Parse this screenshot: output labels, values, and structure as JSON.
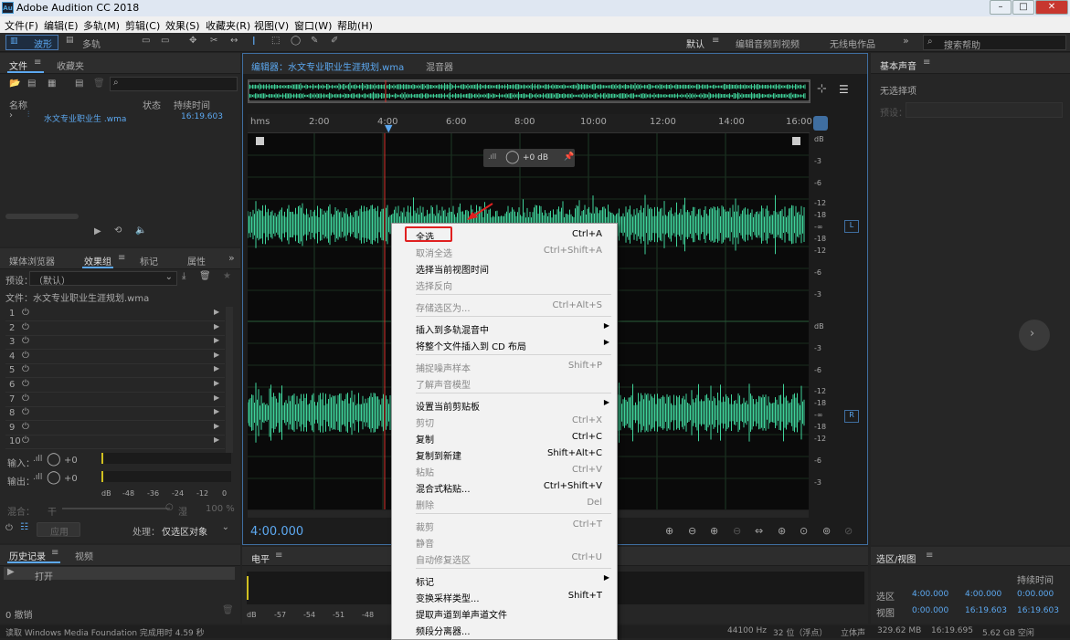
{
  "window": {
    "title": "Adobe Audition CC 2018",
    "app_icon_text": "Au"
  },
  "menu": [
    "文件(F)",
    "编辑(E)",
    "多轨(M)",
    "剪辑(C)",
    "效果(S)",
    "收藏夹(R)",
    "视图(V)",
    "窗口(W)",
    "帮助(H)"
  ],
  "toolbar": {
    "waveform": "波形",
    "multitrack": "多轨",
    "workspace_default": "默认",
    "workspace_edit_video": "编辑音频到视频",
    "workspace_radio": "无线电作品",
    "search_placeholder": "搜索帮助"
  },
  "files_panel": {
    "tab_files": "文件",
    "tab_favorites": "收藏夹",
    "col_name": "名称",
    "col_status": "状态",
    "col_duration": "持续时间",
    "file_name": "水文专业职业生 .wma",
    "file_duration": "16:19.603"
  },
  "effects_panel": {
    "tab_media": "媒体浏览器",
    "tab_effects": "效果组",
    "tab_markers": "标记",
    "tab_props": "属性",
    "preset_label": "预设：",
    "preset_value": "（默认）",
    "file_label": "文件：水文专业职业生涯规划.wma",
    "slots": [
      "1",
      "2",
      "3",
      "4",
      "5",
      "6",
      "7",
      "8",
      "9",
      "10"
    ],
    "input_label": "输入：",
    "output_label": "输出：",
    "input_db": "+0",
    "output_db": "+0",
    "meter_ticks": [
      "dB",
      "-48",
      "-36",
      "-24",
      "-12",
      "0"
    ],
    "mix_label": "混合：",
    "mix_dry": "干",
    "mix_wet": "湿",
    "mix_pct": "100 %",
    "apply_btn": "应用",
    "process_label": "处理：",
    "process_value": "仅选区对象"
  },
  "history_panel": {
    "tab_history": "历史记录",
    "tab_video": "视频",
    "item": "打开",
    "undo_count": "0 撤销"
  },
  "editor": {
    "tab_editor": "编辑器：水文专业职业生涯规划.wma",
    "tab_mixer": "混音器",
    "ruler_unit": "hms",
    "ruler": [
      "2:00",
      "4:00",
      "6:00",
      "8:00",
      "10:00",
      "12:00",
      "14:00",
      "16:00"
    ],
    "hud_db": "+0 dB",
    "time_display": "4:00.000",
    "channel_L": "L",
    "channel_R": "R",
    "db_scale": [
      "dB",
      "-3",
      "-6",
      "-12",
      "-18",
      "-∞",
      "-18",
      "-12",
      "-6",
      "-3"
    ]
  },
  "levels_panel": {
    "title": "电平",
    "ticks": [
      "dB",
      "-57",
      "-54",
      "-51",
      "-48",
      "-45",
      "-42"
    ]
  },
  "essential_sound": {
    "title": "基本声音",
    "no_selection": "无选择项",
    "preset_label": "预设："
  },
  "selection_panel": {
    "title": "选区/视图",
    "col_duration": "持续时间",
    "row_sel": "选区",
    "row_view": "视图",
    "sel_start": "4:00.000",
    "sel_end": "4:00.000",
    "sel_dur": "0:00.000",
    "view_start": "0:00.000",
    "view_end": "16:19.603",
    "view_dur": "16:19.603"
  },
  "context_menu": [
    {
      "label": "全选",
      "shortcut": "Ctrl+A",
      "enabled": true,
      "highlight": true
    },
    {
      "label": "取消全选",
      "shortcut": "Ctrl+Shift+A",
      "enabled": false
    },
    {
      "label": "选择当前视图时间",
      "shortcut": "",
      "enabled": true
    },
    {
      "label": "选择反向",
      "shortcut": "",
      "enabled": false
    },
    {
      "sep": true
    },
    {
      "label": "存储选区为...",
      "shortcut": "Ctrl+Alt+S",
      "enabled": false
    },
    {
      "sep": true
    },
    {
      "label": "插入到多轨混音中",
      "shortcut": "",
      "enabled": true,
      "submenu": true
    },
    {
      "label": "将整个文件插入到 CD 布局",
      "shortcut": "",
      "enabled": true,
      "submenu": true
    },
    {
      "sep": true
    },
    {
      "label": "捕捉噪声样本",
      "shortcut": "Shift+P",
      "enabled": false
    },
    {
      "label": "了解声音模型",
      "shortcut": "",
      "enabled": false
    },
    {
      "sep": true
    },
    {
      "label": "设置当前剪贴板",
      "shortcut": "",
      "enabled": true,
      "submenu": true
    },
    {
      "label": "剪切",
      "shortcut": "Ctrl+X",
      "enabled": false
    },
    {
      "label": "复制",
      "shortcut": "Ctrl+C",
      "enabled": true
    },
    {
      "label": "复制到新建",
      "shortcut": "Shift+Alt+C",
      "enabled": true
    },
    {
      "label": "粘贴",
      "shortcut": "Ctrl+V",
      "enabled": false
    },
    {
      "label": "混合式粘贴...",
      "shortcut": "Ctrl+Shift+V",
      "enabled": true
    },
    {
      "label": "删除",
      "shortcut": "Del",
      "enabled": false
    },
    {
      "sep": true
    },
    {
      "label": "裁剪",
      "shortcut": "Ctrl+T",
      "enabled": false
    },
    {
      "label": "静音",
      "shortcut": "",
      "enabled": false
    },
    {
      "label": "自动修复选区",
      "shortcut": "Ctrl+U",
      "enabled": false
    },
    {
      "sep": true
    },
    {
      "label": "标记",
      "shortcut": "",
      "enabled": true,
      "submenu": true
    },
    {
      "label": "变换采样类型...",
      "shortcut": "Shift+T",
      "enabled": true
    },
    {
      "label": "提取声道到单声道文件",
      "shortcut": "",
      "enabled": true
    },
    {
      "label": "频段分离器...",
      "shortcut": "",
      "enabled": true
    }
  ],
  "status": {
    "left": "读取 Windows Media Foundation 完成用时 4.59 秒",
    "rate": "44100 Hz",
    "bits": "32 位（浮点）",
    "stereo": "立体声",
    "size": "329.62 MB",
    "dur": "16:19.695",
    "free": "5.62 GB 空闲"
  },
  "colors": {
    "wave": "#3fd29a",
    "accent": "#5ca8f0",
    "playhead": "#d8332c",
    "highlight_box": "#e02020"
  }
}
